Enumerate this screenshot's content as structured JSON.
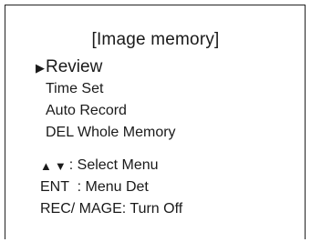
{
  "menu": {
    "title": "[Image memory]",
    "cursor_glyph": "▶",
    "items": [
      {
        "label": "Review",
        "selected": true
      },
      {
        "label": "Time Set",
        "selected": false
      },
      {
        "label": "Auto Record",
        "selected": false
      },
      {
        "label": "DEL Whole Memory",
        "selected": false
      }
    ]
  },
  "hints": {
    "up_arrow": "▲",
    "down_arrow": "▼",
    "select_text": ": Select Menu",
    "ent_text": "ENT  : Menu Det",
    "rec_text": "REC/ MAGE: Turn Off"
  }
}
